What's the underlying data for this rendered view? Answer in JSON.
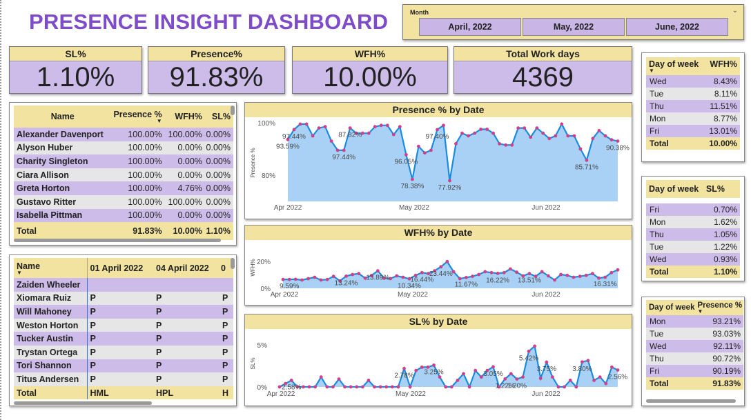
{
  "title": "PRESENCE INSIGHT DASHBOARD",
  "slicer": {
    "label": "Month",
    "options": [
      "April, 2022",
      "May, 2022",
      "June, 2022"
    ]
  },
  "kpis": {
    "sl": {
      "label": "SL%",
      "value": "1.10%"
    },
    "presence": {
      "label": "Presence%",
      "value": "91.83%"
    },
    "wfh": {
      "label": "WFH%",
      "value": "10.00%"
    },
    "workdays": {
      "label": "Total Work days",
      "value": "4369"
    }
  },
  "emp_table": {
    "headers": [
      "Name",
      "Presence %",
      "WFH%",
      "SL%"
    ],
    "rows": [
      [
        "Alexander Davenport",
        "100.00%",
        "100.00%",
        "0.00%"
      ],
      [
        "Alyson Huber",
        "100.00%",
        "0.00%",
        "0.00%"
      ],
      [
        "Charity Singleton",
        "100.00%",
        "0.00%",
        "0.00%"
      ],
      [
        "Ciara Allison",
        "100.00%",
        "0.00%",
        "0.00%"
      ],
      [
        "Greta Horton",
        "100.00%",
        "4.76%",
        "0.00%"
      ],
      [
        "Gustavo Ritter",
        "100.00%",
        "100.00%",
        "0.00%"
      ],
      [
        "Isabella Pittman",
        "100.00%",
        "0.00%",
        "0.00%"
      ]
    ],
    "total": [
      "Total",
      "91.83%",
      "10.00%",
      "1.10%"
    ]
  },
  "matrix": {
    "headers": [
      "Name",
      "01 April 2022",
      "04 April 2022",
      "0"
    ],
    "rows": [
      [
        "Zaiden Wheeler",
        "",
        "",
        ""
      ],
      [
        "Xiomara Ruiz",
        "P",
        "P",
        "P"
      ],
      [
        "Will Mahoney",
        "P",
        "P",
        "P"
      ],
      [
        "Weston Horton",
        "P",
        "P",
        "P"
      ],
      [
        "Tucker Austin",
        "P",
        "P",
        "P"
      ],
      [
        "Trystan Ortega",
        "P",
        "P",
        "P"
      ],
      [
        "Tori Shannon",
        "P",
        "P",
        "P"
      ],
      [
        "Titus Andersen",
        "P",
        "P",
        "P"
      ]
    ],
    "total": [
      "Total",
      "HML",
      "HPL",
      "H"
    ]
  },
  "dow_wfh": {
    "headers": [
      "Day of week",
      "WFH%"
    ],
    "rows": [
      [
        "Wed",
        "8.43%"
      ],
      [
        "Tue",
        "8.11%"
      ],
      [
        "Thu",
        "11.51%"
      ],
      [
        "Mon",
        "8.77%"
      ],
      [
        "Fri",
        "13.01%"
      ]
    ],
    "total": [
      "Total",
      "10.00%"
    ]
  },
  "dow_sl": {
    "headers": [
      "Day of week",
      "SL%"
    ],
    "rows": [
      [
        "Fri",
        "0.70%"
      ],
      [
        "Mon",
        "1.62%"
      ],
      [
        "Thu",
        "1.05%"
      ],
      [
        "Tue",
        "1.22%"
      ],
      [
        "Wed",
        "0.93%"
      ]
    ],
    "total": [
      "Total",
      "1.10%"
    ]
  },
  "dow_presence": {
    "headers": [
      "Day of week",
      "Presence %"
    ],
    "rows": [
      [
        "Mon",
        "93.21%"
      ],
      [
        "Tue",
        "93.03%"
      ],
      [
        "Wed",
        "92.11%"
      ],
      [
        "Thu",
        "90.72%"
      ],
      [
        "Fri",
        "90.19%"
      ]
    ],
    "total": [
      "Total",
      "91.83%"
    ]
  },
  "colors": {
    "accent": "#7e4bc9",
    "header": "#f3e3a1",
    "row_purple": "#cdbbe9",
    "line": "#1a8be0",
    "area": "#a8d1f5",
    "marker": "#d13f8a"
  },
  "chart_data": [
    {
      "type": "area",
      "title": "Presence % by Date",
      "ylabel": "Presence %",
      "y_ticks": [
        "100%",
        "80%"
      ],
      "x_ticks": [
        "Apr 2022",
        "May 2022",
        "Jun 2022"
      ],
      "ylim": [
        70,
        100
      ],
      "values": [
        93.6,
        97.4,
        99.5,
        99.5,
        95.0,
        98.0,
        98.5,
        93.0,
        89.5,
        89.5,
        98.0,
        96.0,
        96.0,
        96.0,
        98.5,
        99.0,
        99.0,
        95.5,
        98.5,
        87.8,
        78.4,
        91.0,
        88.5,
        89.5,
        97.4,
        99.0,
        77.9,
        92.0,
        96.0,
        95.0,
        96.0,
        97.5,
        97.5,
        96.0,
        92.0,
        91.5,
        91.5,
        98.0,
        98.0,
        94.5,
        98.0,
        96.0,
        94.0,
        95.0,
        99.5,
        95.0,
        95.0,
        90.0,
        85.7,
        94.0,
        97.0,
        95.0,
        93.5,
        93.0
      ],
      "data_labels": [
        {
          "index": 0,
          "text": "93.59%"
        },
        {
          "index": 1,
          "text": "97.44%"
        },
        {
          "index": 9,
          "text": "97.44%"
        },
        {
          "index": 10,
          "text": "87.82%"
        },
        {
          "index": 19,
          "text": "96.05%"
        },
        {
          "index": 20,
          "text": "78.38%"
        },
        {
          "index": 24,
          "text": "97.40%"
        },
        {
          "index": 26,
          "text": "77.92%"
        },
        {
          "index": 48,
          "text": "85.71%"
        },
        {
          "index": 53,
          "text": "90.38%"
        }
      ]
    },
    {
      "type": "area",
      "title": "WFH% by Date",
      "ylabel": "WFH%",
      "y_ticks": [
        "20%",
        "0%"
      ],
      "x_ticks": [
        "Apr 2022",
        "May 2022",
        "Jun 2022"
      ],
      "ylim": [
        0,
        30
      ],
      "values": [
        9.6,
        9.6,
        9.8,
        9.0,
        10.5,
        12.0,
        9.0,
        9.5,
        13.0,
        8.0,
        13.2,
        15.0,
        16.0,
        11.0,
        13.9,
        19.0,
        11.0,
        10.5,
        13.5,
        12.0,
        10.3,
        14.0,
        17.0,
        16.0,
        19.0,
        23.4,
        29.0,
        18.0,
        10.5,
        11.7,
        13.0,
        15.0,
        18.0,
        17.0,
        16.2,
        17.0,
        21.0,
        17.5,
        13.5,
        16.0,
        13.0,
        18.0,
        13.5,
        9.0,
        15.0,
        14.0,
        12.0,
        13.0,
        14.0,
        16.0,
        11.0,
        12.0,
        17.0,
        20.0
      ],
      "data_labels": [
        {
          "index": 1,
          "text": "9.59%"
        },
        {
          "index": 10,
          "text": "13.24%"
        },
        {
          "index": 15,
          "text": "13.89%"
        },
        {
          "index": 20,
          "text": "10.34%"
        },
        {
          "index": 22,
          "text": "16.44%"
        },
        {
          "index": 25,
          "text": "23.44%"
        },
        {
          "index": 29,
          "text": "11.67%"
        },
        {
          "index": 34,
          "text": "16.22%"
        },
        {
          "index": 39,
          "text": "13.51%"
        },
        {
          "index": 51,
          "text": "16.31%"
        }
      ]
    },
    {
      "type": "area",
      "title": "SL% by Date",
      "ylabel": "SL%",
      "y_ticks": [
        "5%",
        "0%"
      ],
      "x_ticks": [
        "Apr 2022",
        "May 2022",
        "Jun 2022"
      ],
      "ylim": [
        0,
        6.5
      ],
      "values": [
        0,
        0.5,
        1.0,
        0,
        0,
        0,
        0,
        1.5,
        0,
        0,
        1.2,
        0,
        0,
        0,
        0,
        1.0,
        0,
        0,
        0,
        0,
        0,
        2.8,
        0,
        2.5,
        3.0,
        3.0,
        3.3,
        1.5,
        0,
        0,
        1.0,
        2.0,
        0,
        2.5,
        1.5,
        2.5,
        3.05,
        0,
        1.22,
        2.0,
        1.2,
        1.5,
        5.42,
        6.2,
        1.3,
        3.75,
        1.5,
        0,
        0,
        1.0,
        0,
        3.8,
        4.0,
        1.0,
        1.5,
        0.5,
        3.0,
        2.56
      ],
      "data_labels": [
        {
          "index": 2,
          "text": "2.58%"
        },
        {
          "index": 21,
          "text": "2.78%"
        },
        {
          "index": 26,
          "text": "3.25%"
        },
        {
          "index": 36,
          "text": "3.05%"
        },
        {
          "index": 38,
          "text": "1.22%"
        },
        {
          "index": 40,
          "text": "1.20%"
        },
        {
          "index": 42,
          "text": "5.42%"
        },
        {
          "index": 45,
          "text": "3.75%"
        },
        {
          "index": 51,
          "text": "3.80%"
        },
        {
          "index": 57,
          "text": "2.56%"
        }
      ]
    }
  ]
}
